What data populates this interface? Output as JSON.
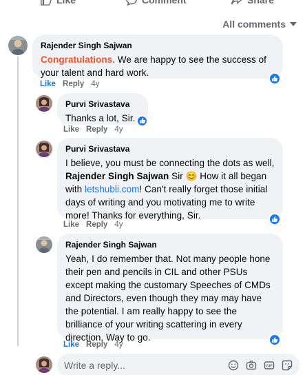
{
  "top_actions": {
    "like": "Like",
    "comment": "Comment",
    "share": "Share"
  },
  "filter": {
    "label": "All comments"
  },
  "comments": [
    {
      "author": "Rajender Singh Sajwan",
      "text_highlight": "Congratulations",
      "text_rest": ". We are happy to see the success of your talent and hard work.",
      "like": "Like",
      "reply": "Reply",
      "age": "4y"
    },
    {
      "author": "Purvi Srivastava",
      "text": "Thanks a lot, Sir.",
      "like": "Like",
      "reply": "Reply",
      "age": "4y"
    },
    {
      "author": "Purvi Srivastava",
      "text_1": "I believe, you must be connecting the dots as well, ",
      "mention": "Rajender Singh Sajwan",
      "text_2": " Sir ",
      "emoji": "😊",
      "text_3": " How it all began with ",
      "link": "letshubli.com",
      "text_4": "! Can't really forget those initial days of writing and you motivating me to write more! Thanks for everything, Sir.",
      "like": "Like",
      "reply": "Reply",
      "age": "4y"
    },
    {
      "author": "Rajender Singh Sajwan",
      "text": "Yeah, I do remember that. Not many people hone their pen and pencils in CIL and other PSUs except making the customary Speeches of CMDs and Directors, even though they may may have the potential. I am really happy to see the brilliance of your writing scattering in every direction. Way to go.",
      "like": "Like",
      "reply": "Reply",
      "age": "4y"
    }
  ],
  "reply_box": {
    "placeholder": "Write a reply..."
  },
  "icons": [
    "like-thumb-icon",
    "comment-icon",
    "share-icon",
    "chevron-down-icon",
    "smiley-icon",
    "camera-icon",
    "gif-icon",
    "sticker-icon"
  ],
  "colors": {
    "accent": "#1877f2",
    "highlight": "#f0542d",
    "bubble": "#f0f2f5",
    "muted": "#65676b"
  }
}
